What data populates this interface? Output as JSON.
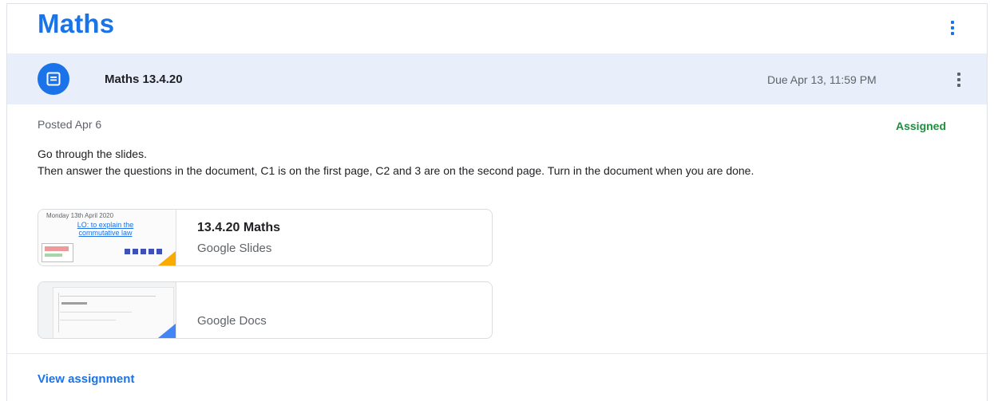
{
  "header": {
    "title": "Maths",
    "more_icon": "more-vertical-icon",
    "accent": "#1a73e8"
  },
  "assignment": {
    "icon": "assignment-icon",
    "name": "Maths 13.4.20",
    "due": "Due Apr 13, 11:59 PM",
    "posted": "Posted Apr 6",
    "status": "Assigned",
    "status_color": "#1e8e3e",
    "instructions": [
      "Go through the slides.",
      "Then answer the questions in the document, C1 is on the first page, C2 and 3 are on the second page. Turn in the document when you are done."
    ]
  },
  "attachments": [
    {
      "title": "13.4.20 Maths",
      "type": "Google Slides",
      "thumb_date": "Monday 13th April 2020",
      "thumb_lo": "LO: to explain the commutative law",
      "corner_color": "#f9ab00"
    },
    {
      "title": "",
      "type": "Google Docs",
      "corner_color": "#4285f4"
    }
  ],
  "footer": {
    "view_label": "View assignment"
  }
}
